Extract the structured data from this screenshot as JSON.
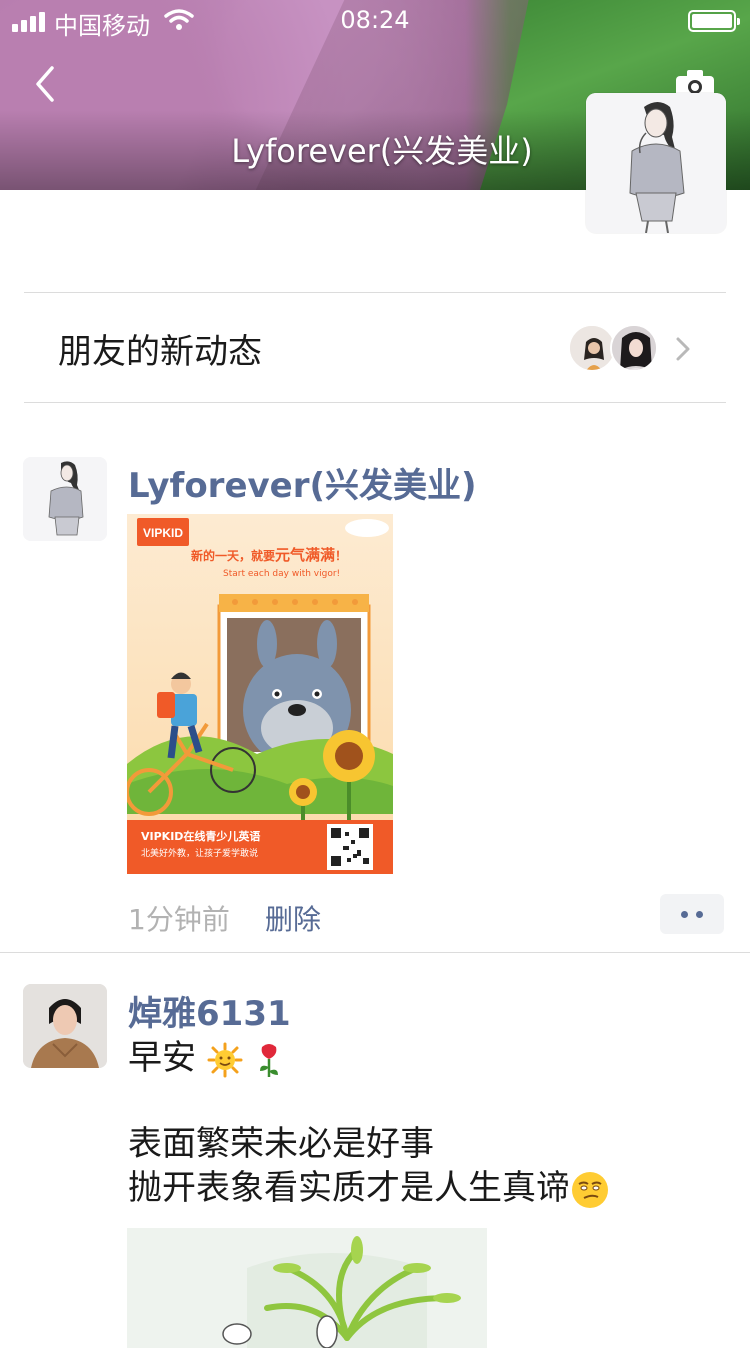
{
  "status_bar": {
    "carrier": "中国移动",
    "time": "08:24"
  },
  "cover": {
    "title": "Lyforever(兴发美业)",
    "back_icon": "chevron-left-icon",
    "camera_icon": "camera-icon"
  },
  "friend_updates": {
    "label": "朋友的新动态",
    "chevron": "chevron-right-icon"
  },
  "posts": [
    {
      "author": "Lyforever(兴发美业)",
      "image": {
        "brand": "VIPKID",
        "headline_cn_a": "新的一天，就要",
        "headline_cn_b": "元气满满",
        "headline_cn_end": "！",
        "headline_en": "Start each day with vigor!",
        "footer_line1": "VIPKID在线青少儿英语",
        "footer_line2": "北美好外教，让孩子爱学敢说"
      },
      "time": "1分钟前",
      "delete_label": "删除",
      "more_icon": "more-dots-icon"
    },
    {
      "author": "焯雅6131",
      "line1": "早安",
      "line1_emojis": [
        "sun-emoji",
        "rose-emoji"
      ],
      "line2": "表面繁荣未必是好事",
      "line3": "抛开表象看实质才是人生真谛",
      "line3_emoji": "smirk-emoji"
    }
  ],
  "colors": {
    "link_blue": "#576b95",
    "meta_gray": "#b2b2b2",
    "divider": "#dcdcdc",
    "poster_orange": "#f05a28"
  }
}
